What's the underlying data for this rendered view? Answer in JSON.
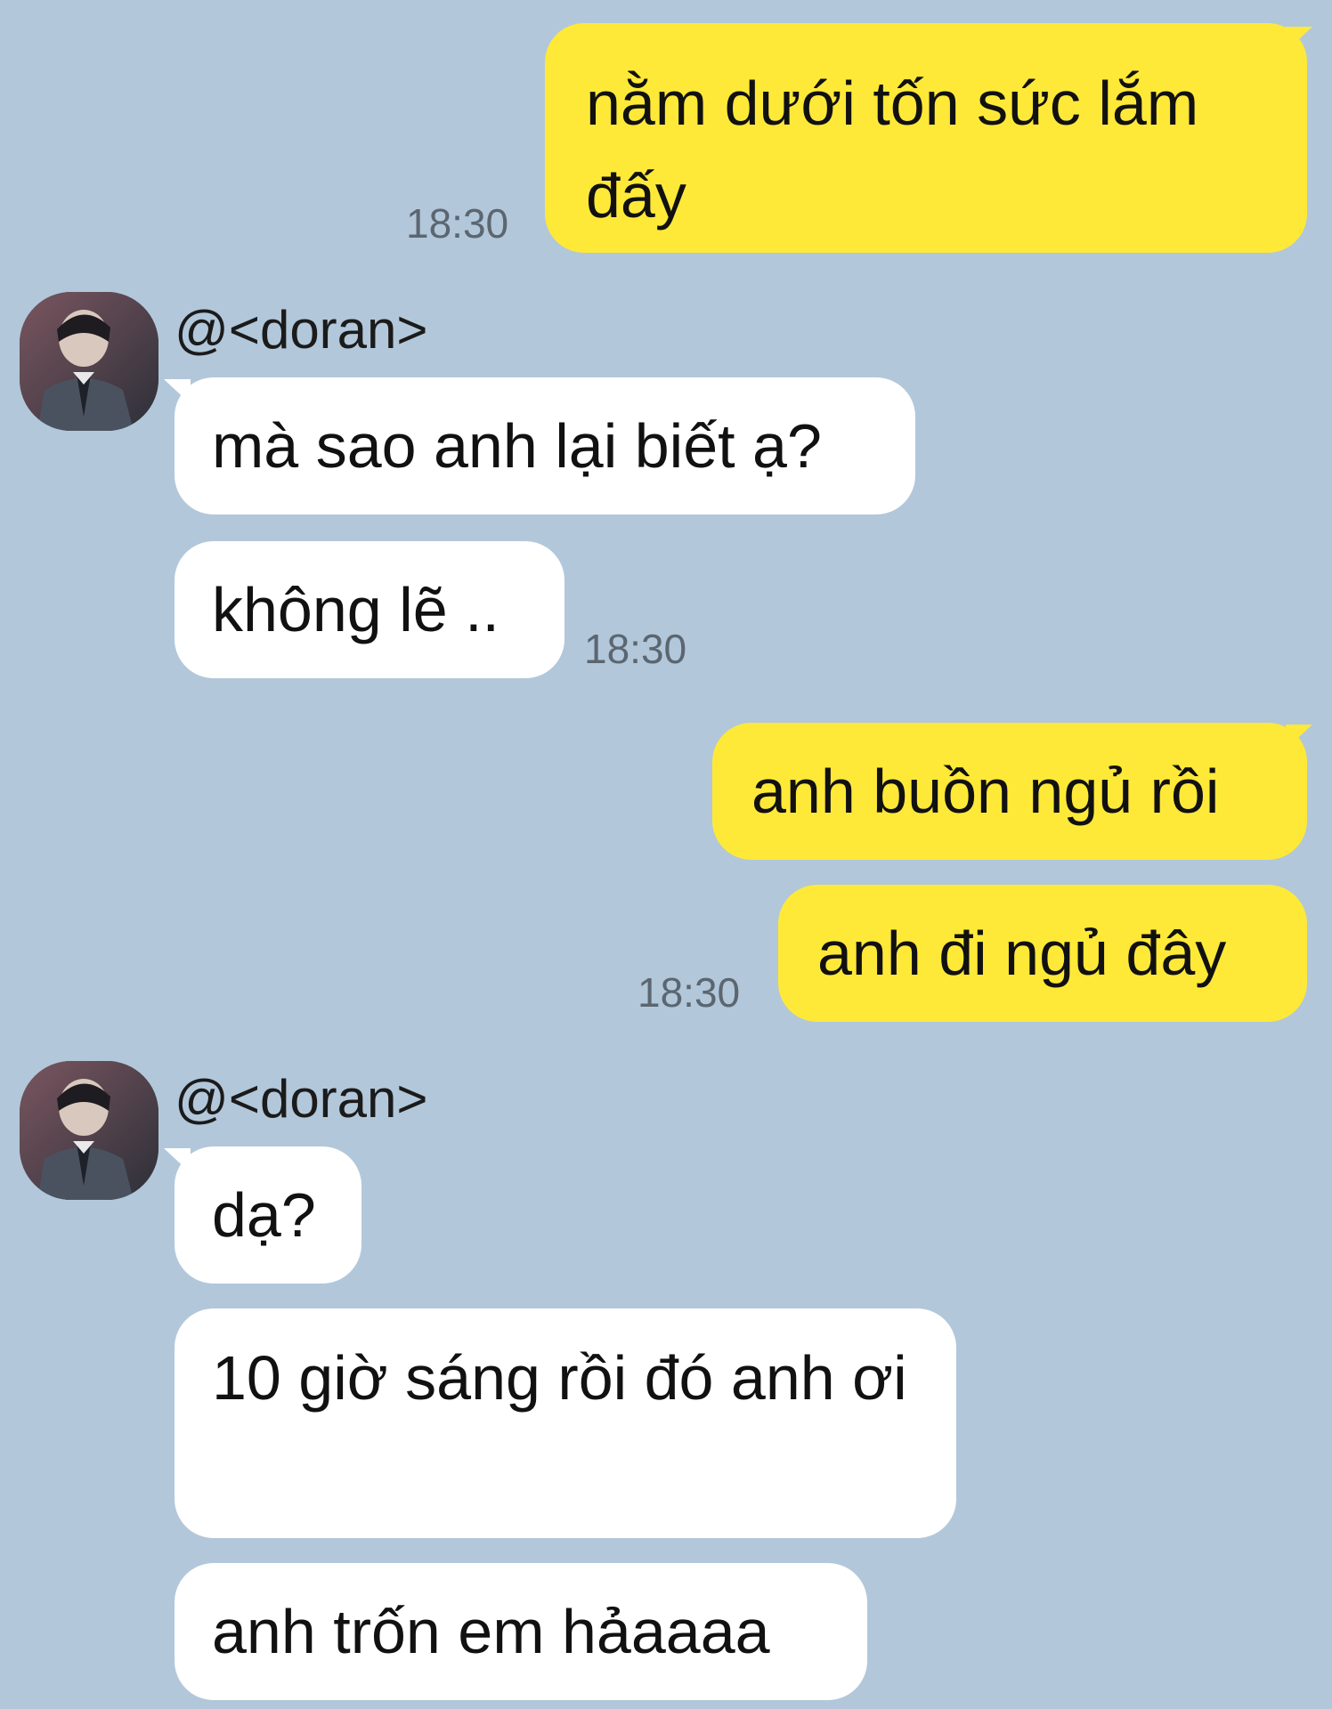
{
  "messages": [
    {
      "side": "mine",
      "text": "nằm dưới tốn sức lắm đấy",
      "time": "18:30"
    },
    {
      "side": "theirs",
      "sender": "@<doran>",
      "text": "mà sao anh lại biết ạ?"
    },
    {
      "side": "theirs",
      "text": "không lẽ ..",
      "time": "18:30"
    },
    {
      "side": "mine",
      "text": "anh buồn ngủ rồi"
    },
    {
      "side": "mine",
      "text": "anh đi ngủ đây",
      "time": "18:30"
    },
    {
      "side": "theirs",
      "sender": "@<doran>",
      "text": "dạ?"
    },
    {
      "side": "theirs",
      "text": "10 giờ sáng rồi đó anh ơi"
    },
    {
      "side": "theirs",
      "text": "anh trốn em hảaaaa"
    }
  ],
  "colors": {
    "background": "#b2c7da",
    "mine_bubble": "#ffe938",
    "theirs_bubble": "#ffffff"
  },
  "avatar_icon": "user-avatar-photo"
}
